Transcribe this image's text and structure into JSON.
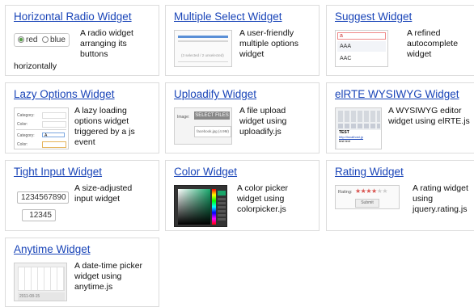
{
  "widgets": [
    {
      "title": "Horizontal Radio Widget",
      "desc_right": [
        "A radio widget",
        "arranging its",
        "buttons"
      ],
      "desc_bottom": "horizontally",
      "thumb": {
        "options": [
          "red",
          "blue"
        ]
      }
    },
    {
      "title": "Multiple Select Widget",
      "desc_right": [
        "A user-friendly",
        "multiple options",
        "widget"
      ],
      "thumb": {
        "caption": "(3 selected / 2 unselected)"
      }
    },
    {
      "title": "Suggest Widget",
      "desc_right": [
        "A refined",
        "autocomplete",
        "widget"
      ],
      "thumb": {
        "input": "a",
        "items": [
          "AAA",
          "AAC"
        ]
      }
    },
    {
      "title": "Lazy Options Widget",
      "desc_right": [
        "A lazy loading",
        "options widget",
        "triggered by a js",
        "event"
      ],
      "thumb": {
        "labels": [
          "Category:",
          "Color:",
          "Category:",
          "Color:"
        ],
        "value": "A"
      }
    },
    {
      "title": "Uploadify Widget",
      "desc_right": [
        "A file upload",
        "widget using",
        "uploadify.js"
      ],
      "thumb": {
        "label": "Image:",
        "button": "SELECT FILES",
        "file": "facebook.jpg (4.9M)"
      }
    },
    {
      "title": "elRTE WYSIWYG Widget",
      "desc_right": [
        "A WYSIWYG editor",
        "widget using elRTE.js"
      ],
      "thumb": {
        "heading": "TEST",
        "link": "http://localhost.jp",
        "text": "test text"
      }
    },
    {
      "title": "Tight Input Widget",
      "desc_right": [
        "A size-adjusted",
        "input widget"
      ],
      "thumb": {
        "values": [
          "1234567890",
          "12345"
        ]
      }
    },
    {
      "title": "Color Widget",
      "desc_right": [
        "A color picker",
        "widget using",
        "colorpicker.js"
      ]
    },
    {
      "title": "Rating Widget",
      "desc_right": [
        "A rating widget",
        "using",
        "jquery.rating.js"
      ],
      "thumb": {
        "label": "Rating:",
        "submit": "Submit",
        "rating": 4,
        "max": 6
      }
    },
    {
      "title": "Anytime Widget",
      "desc_right": [
        "A date-time picker",
        "widget using",
        "anytime.js"
      ],
      "thumb": {
        "date": "2011-08-15"
      }
    }
  ]
}
